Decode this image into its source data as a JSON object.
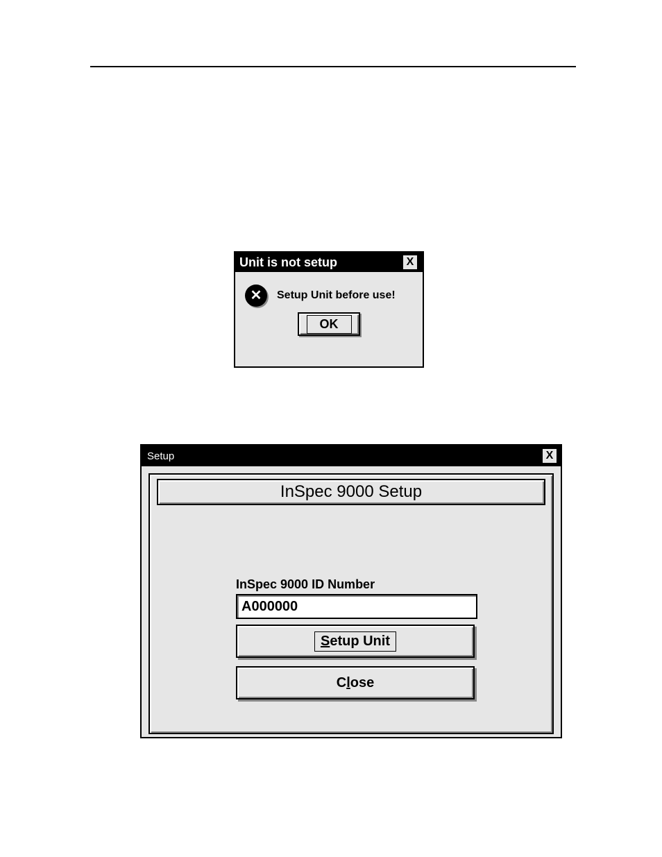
{
  "error_dialog": {
    "title": "Unit  is not setup",
    "message": "Setup Unit before use!",
    "ok_label": "OK",
    "icon_name": "x-circle-icon"
  },
  "setup_dialog": {
    "window_title": "Setup",
    "heading": "InSpec 9000 Setup",
    "id_label": "InSpec 9000 ID Number",
    "id_value": "A000000",
    "setup_button_prefix": "S",
    "setup_button_rest": "etup Unit",
    "close_button_prefix": "C",
    "close_button_mid": "l",
    "close_button_rest": "ose"
  }
}
